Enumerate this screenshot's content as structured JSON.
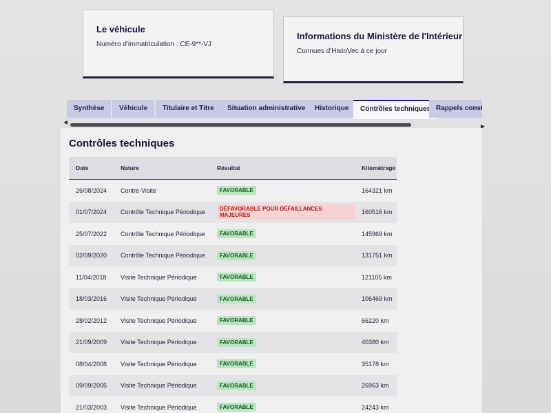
{
  "vehicle_card": {
    "title": "Le véhicule",
    "registration": "Numéro d'immatriculation : CE-9**-VJ"
  },
  "ministry_card": {
    "title": "Informations du Ministère de l'Intérieur",
    "subtitle": "Connues d'HistoVec à ce jour"
  },
  "tabs": [
    {
      "label": "Synthèse",
      "active": false
    },
    {
      "label": "Véhicule",
      "active": false
    },
    {
      "label": "Titulaire et Titre",
      "active": false
    },
    {
      "label": "Situation administrative",
      "active": false
    },
    {
      "label": "Historique",
      "active": false
    },
    {
      "label": "Contrôles techniques",
      "active": true
    },
    {
      "label": "Rappels constructeur",
      "active": false
    }
  ],
  "section": {
    "title": "Contrôles techniques",
    "columns": [
      "Date",
      "Nature",
      "Résultat",
      "Kilométrage"
    ],
    "rows": [
      {
        "date": "26/08/2024",
        "nature": "Contre-Visite",
        "result": "FAVORABLE",
        "status": "ok",
        "km": "164321 km"
      },
      {
        "date": "01/07/2024",
        "nature": "Contrôle Technique Périodique",
        "result": "DÉFAVORABLE POUR DÉFAILLANCES MAJEURES",
        "status": "ko",
        "km": "160516 km"
      },
      {
        "date": "25/07/2022",
        "nature": "Contrôle Technique Périodique",
        "result": "FAVORABLE",
        "status": "ok",
        "km": "145969 km"
      },
      {
        "date": "02/09/2020",
        "nature": "Contrôle Technique Périodique",
        "result": "FAVORABLE",
        "status": "ok",
        "km": "131751 km"
      },
      {
        "date": "11/04/2018",
        "nature": "Visite Technique Périodique",
        "result": "FAVORABLE",
        "status": "ok",
        "km": "121105 km"
      },
      {
        "date": "18/03/2016",
        "nature": "Visite Technique Périodique",
        "result": "FAVORABLE",
        "status": "ok",
        "km": "106469 km"
      },
      {
        "date": "28/02/2012",
        "nature": "Visite Technique Périodique",
        "result": "FAVORABLE",
        "status": "ok",
        "km": "66220 km"
      },
      {
        "date": "21/09/2009",
        "nature": "Visite Technique Périodique",
        "result": "FAVORABLE",
        "status": "ok",
        "km": "40380 km"
      },
      {
        "date": "08/04/2008",
        "nature": "Visite Technique Périodique",
        "result": "FAVORABLE",
        "status": "ok",
        "km": "35178 km"
      },
      {
        "date": "09/09/2005",
        "nature": "Visite Technique Périodique",
        "result": "FAVORABLE",
        "status": "ok",
        "km": "26963 km"
      },
      {
        "date": "21/03/2003",
        "nature": "Visite Technique Périodique",
        "result": "FAVORABLE",
        "status": "ok",
        "km": "24243 km"
      }
    ]
  },
  "colors": {
    "tab_bg": "#c9cae6",
    "favorable_bg": "#b8e6c0",
    "unfavorable_bg": "#f8d2d2",
    "unfavorable_text": "#b11a1a"
  },
  "icons": {
    "scroll_left": "triangle-left-icon",
    "scroll_right": "triangle-right-icon"
  }
}
